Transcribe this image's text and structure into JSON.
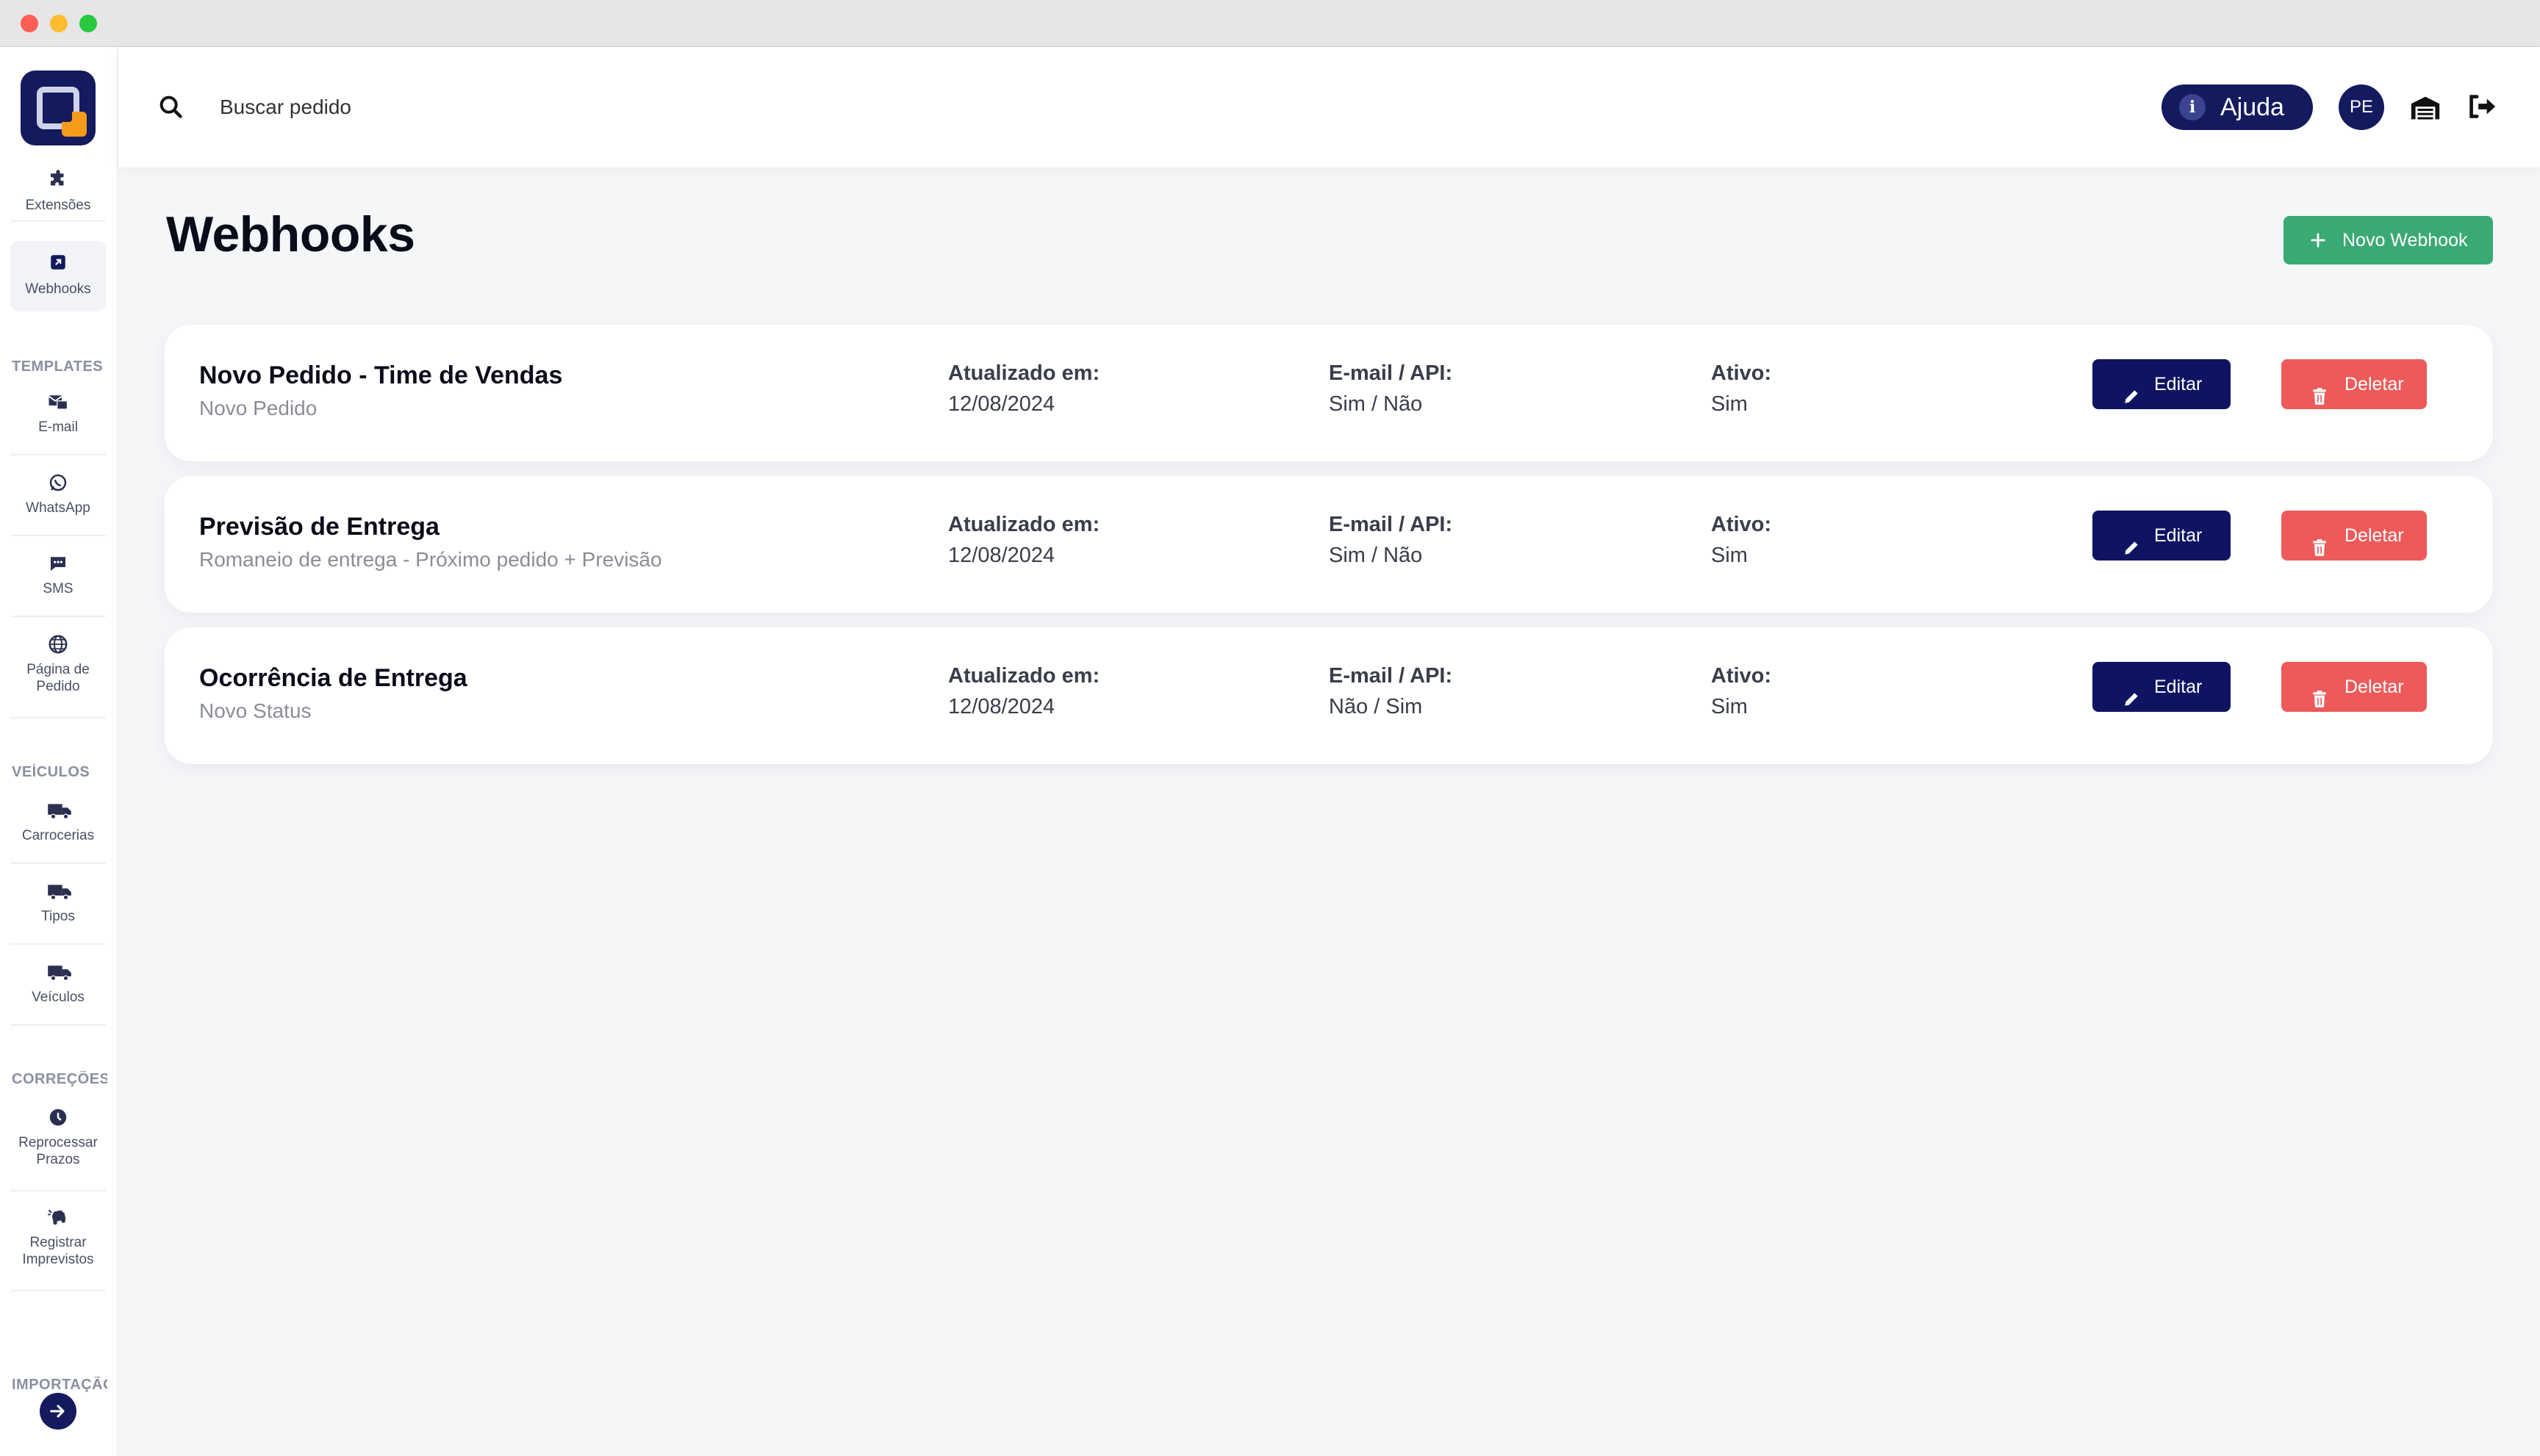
{
  "search": {
    "placeholder": "Buscar pedido"
  },
  "header": {
    "help_label": "Ajuda",
    "avatar_initials": "PE"
  },
  "sidebar": {
    "items": [
      {
        "label": "Extensões",
        "icon": "puzzle-icon"
      },
      {
        "label": "Webhooks",
        "icon": "webhook-icon"
      }
    ],
    "sections": [
      {
        "title": "TEMPLATES",
        "items": [
          {
            "label": "E-mail",
            "icon": "email-icon"
          },
          {
            "label": "WhatsApp",
            "icon": "whatsapp-icon"
          },
          {
            "label": "SMS",
            "icon": "sms-icon"
          },
          {
            "label": "Página de Pedido",
            "icon": "globe-icon"
          }
        ]
      },
      {
        "title": "VEÍCULOS",
        "items": [
          {
            "label": "Carrocerias",
            "icon": "truck-icon"
          },
          {
            "label": "Tipos",
            "icon": "truck-icon"
          },
          {
            "label": "Veículos",
            "icon": "truck-icon"
          }
        ]
      },
      {
        "title": "CORREÇÕES",
        "items": [
          {
            "label": "Reprocessar Prazos",
            "icon": "clock-icon"
          },
          {
            "label": "Registrar Imprevistos",
            "icon": "car-crash-icon"
          }
        ]
      },
      {
        "title": "IMPORTAÇÃO",
        "items": []
      }
    ]
  },
  "main": {
    "title": "Webhooks",
    "new_button": "Novo Webhook",
    "labels": {
      "updated": "Atualizado em:",
      "email_api": "E-mail / API:",
      "active": "Ativo:",
      "edit": "Editar",
      "delete": "Deletar"
    },
    "webhooks": [
      {
        "name": "Novo Pedido - Time de Vendas",
        "event": "Novo Pedido",
        "updated": "12/08/2024",
        "email_api": "Sim / Não",
        "active": "Sim"
      },
      {
        "name": "Previsão de Entrega",
        "event": "Romaneio de entrega - Próximo pedido + Previsão",
        "updated": "12/08/2024",
        "email_api": "Sim / Não",
        "active": "Sim"
      },
      {
        "name": "Ocorrência de Entrega",
        "event": "Novo Status",
        "updated": "12/08/2024",
        "email_api": "Não / Sim",
        "active": "Sim"
      }
    ]
  },
  "colors": {
    "brand": "#141a5e",
    "success": "#3aaa74",
    "danger": "#ee5a5a",
    "accent": "#f59a1b"
  }
}
